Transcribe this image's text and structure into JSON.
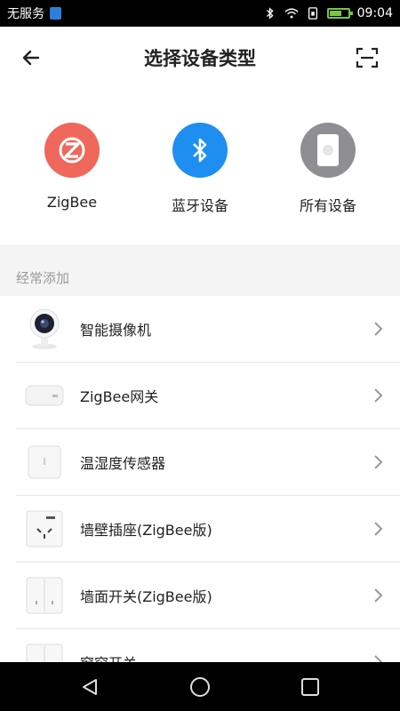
{
  "status_bar": {
    "carrier": "无服务",
    "time": "09:04"
  },
  "header": {
    "title": "选择设备类型"
  },
  "device_types": [
    {
      "label": "ZigBee",
      "icon": "zigbee-icon",
      "color": "#f0675b"
    },
    {
      "label": "蓝牙设备",
      "icon": "bluetooth-icon",
      "color": "#1e8ff0"
    },
    {
      "label": "所有设备",
      "icon": "device-icon",
      "color": "#8f8f93"
    }
  ],
  "section": {
    "title": "经常添加"
  },
  "devices": [
    {
      "name": "智能摄像机",
      "icon": "camera-icon"
    },
    {
      "name": "ZigBee网关",
      "icon": "gateway-icon"
    },
    {
      "name": "温湿度传感器",
      "icon": "sensor-icon"
    },
    {
      "name": "墙壁插座(ZigBee版)",
      "icon": "socket-icon"
    },
    {
      "name": "墙面开关(ZigBee版)",
      "icon": "wall-switch-icon"
    },
    {
      "name": "窗帘开关",
      "icon": "curtain-switch-icon"
    }
  ]
}
